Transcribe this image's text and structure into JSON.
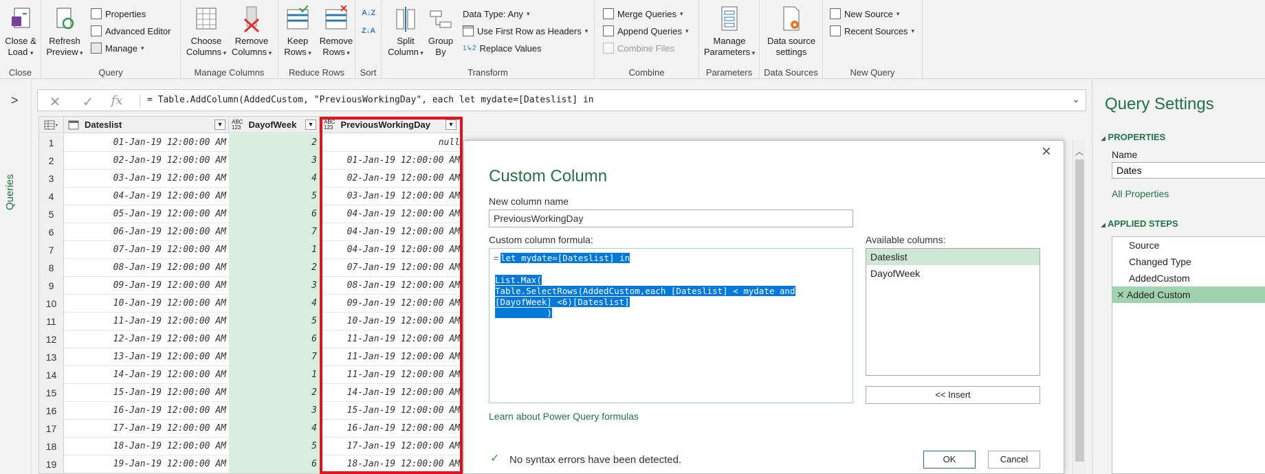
{
  "ribbon": {
    "groups": {
      "close": {
        "label": "Close",
        "close_load": "Close &\nLoad"
      },
      "query": {
        "label": "Query",
        "refresh_preview": "Refresh\nPreview",
        "properties": "Properties",
        "advanced_editor": "Advanced Editor",
        "manage": "Manage"
      },
      "manage_columns": {
        "label": "Manage Columns",
        "choose_columns": "Choose\nColumns",
        "remove_columns": "Remove\nColumns"
      },
      "reduce_rows": {
        "label": "Reduce Rows",
        "keep_rows": "Keep\nRows",
        "remove_rows": "Remove\nRows"
      },
      "sort": {
        "label": "Sort"
      },
      "transform": {
        "label": "Transform",
        "split_column": "Split\nColumn",
        "group_by": "Group\nBy",
        "data_type": "Data Type: Any",
        "use_first_row": "Use First Row as Headers",
        "replace_values": "Replace Values"
      },
      "combine": {
        "label": "Combine",
        "merge_queries": "Merge Queries",
        "append_queries": "Append Queries",
        "combine_files": "Combine Files"
      },
      "parameters": {
        "label": "Parameters",
        "manage_parameters": "Manage\nParameters"
      },
      "data_sources": {
        "label": "Data Sources",
        "data_source_settings": "Data source\nsettings"
      },
      "new_query": {
        "label": "New Query",
        "new_source": "New Source",
        "recent_sources": "Recent Sources"
      }
    }
  },
  "leftbar": {
    "queries_label": "Queries",
    "expand_glyph": ">"
  },
  "formula_bar": {
    "fx": "fx",
    "text": "= Table.AddColumn(AddedCustom, \"PreviousWorkingDay\", each let mydate=[Dateslist] in"
  },
  "grid": {
    "columns": [
      {
        "name": "Dateslist",
        "type_badge": "date"
      },
      {
        "name": "DayofWeek",
        "type_badge": "ABC\n123"
      },
      {
        "name": "PreviousWorkingDay",
        "type_badge": "ABC\n123"
      }
    ],
    "rows": [
      {
        "n": "1",
        "date": "01-Jan-19 12:00:00 AM",
        "dow": "2",
        "prev": "null"
      },
      {
        "n": "2",
        "date": "02-Jan-19 12:00:00 AM",
        "dow": "3",
        "prev": "01-Jan-19 12:00:00 AM"
      },
      {
        "n": "3",
        "date": "03-Jan-19 12:00:00 AM",
        "dow": "4",
        "prev": "02-Jan-19 12:00:00 AM"
      },
      {
        "n": "4",
        "date": "04-Jan-19 12:00:00 AM",
        "dow": "5",
        "prev": "03-Jan-19 12:00:00 AM"
      },
      {
        "n": "5",
        "date": "05-Jan-19 12:00:00 AM",
        "dow": "6",
        "prev": "04-Jan-19 12:00:00 AM"
      },
      {
        "n": "6",
        "date": "06-Jan-19 12:00:00 AM",
        "dow": "7",
        "prev": "04-Jan-19 12:00:00 AM"
      },
      {
        "n": "7",
        "date": "07-Jan-19 12:00:00 AM",
        "dow": "1",
        "prev": "04-Jan-19 12:00:00 AM"
      },
      {
        "n": "8",
        "date": "08-Jan-19 12:00:00 AM",
        "dow": "2",
        "prev": "07-Jan-19 12:00:00 AM"
      },
      {
        "n": "9",
        "date": "09-Jan-19 12:00:00 AM",
        "dow": "3",
        "prev": "08-Jan-19 12:00:00 AM"
      },
      {
        "n": "10",
        "date": "10-Jan-19 12:00:00 AM",
        "dow": "4",
        "prev": "09-Jan-19 12:00:00 AM"
      },
      {
        "n": "11",
        "date": "11-Jan-19 12:00:00 AM",
        "dow": "5",
        "prev": "10-Jan-19 12:00:00 AM"
      },
      {
        "n": "12",
        "date": "12-Jan-19 12:00:00 AM",
        "dow": "6",
        "prev": "11-Jan-19 12:00:00 AM"
      },
      {
        "n": "13",
        "date": "13-Jan-19 12:00:00 AM",
        "dow": "7",
        "prev": "11-Jan-19 12:00:00 AM"
      },
      {
        "n": "14",
        "date": "14-Jan-19 12:00:00 AM",
        "dow": "1",
        "prev": "11-Jan-19 12:00:00 AM"
      },
      {
        "n": "15",
        "date": "15-Jan-19 12:00:00 AM",
        "dow": "2",
        "prev": "14-Jan-19 12:00:00 AM"
      },
      {
        "n": "16",
        "date": "16-Jan-19 12:00:00 AM",
        "dow": "3",
        "prev": "15-Jan-19 12:00:00 AM"
      },
      {
        "n": "17",
        "date": "17-Jan-19 12:00:00 AM",
        "dow": "4",
        "prev": "16-Jan-19 12:00:00 AM"
      },
      {
        "n": "18",
        "date": "18-Jan-19 12:00:00 AM",
        "dow": "5",
        "prev": "17-Jan-19 12:00:00 AM"
      },
      {
        "n": "19",
        "date": "19-Jan-19 12:00:00 AM",
        "dow": "6",
        "prev": "18-Jan-19 12:00:00 AM"
      }
    ]
  },
  "dialog": {
    "title": "Custom Column",
    "new_column_label": "New column name",
    "new_column_value": "PreviousWorkingDay",
    "formula_label": "Custom column formula:",
    "formula_prefix": "=",
    "formula_lines": [
      "let mydate=[Dateslist] in",
      "",
      "List.Max(",
      "Table.SelectRows(AddedCustom,each [Dateslist] < mydate and",
      "[DayofWeek] <6)[Dateslist]",
      "          )"
    ],
    "available_label": "Available columns:",
    "available_columns": [
      "Dateslist",
      "DayofWeek"
    ],
    "insert_button": "<< Insert",
    "learn_link": "Learn about Power Query formulas",
    "status": "No syntax errors have been detected.",
    "ok": "OK",
    "cancel": "Cancel",
    "close_glyph": "×"
  },
  "settings": {
    "title": "Query Settings",
    "properties_header": "PROPERTIES",
    "name_label": "Name",
    "name_value": "Dates",
    "all_properties": "All Properties",
    "applied_steps_header": "APPLIED STEPS",
    "steps": [
      "Source",
      "Changed Type",
      "AddedCustom",
      "Added Custom"
    ]
  },
  "colors": {
    "accent_green": "#217346",
    "highlight": "#cfe8d6",
    "red": "#e0141e",
    "selection": "#0078d7"
  }
}
